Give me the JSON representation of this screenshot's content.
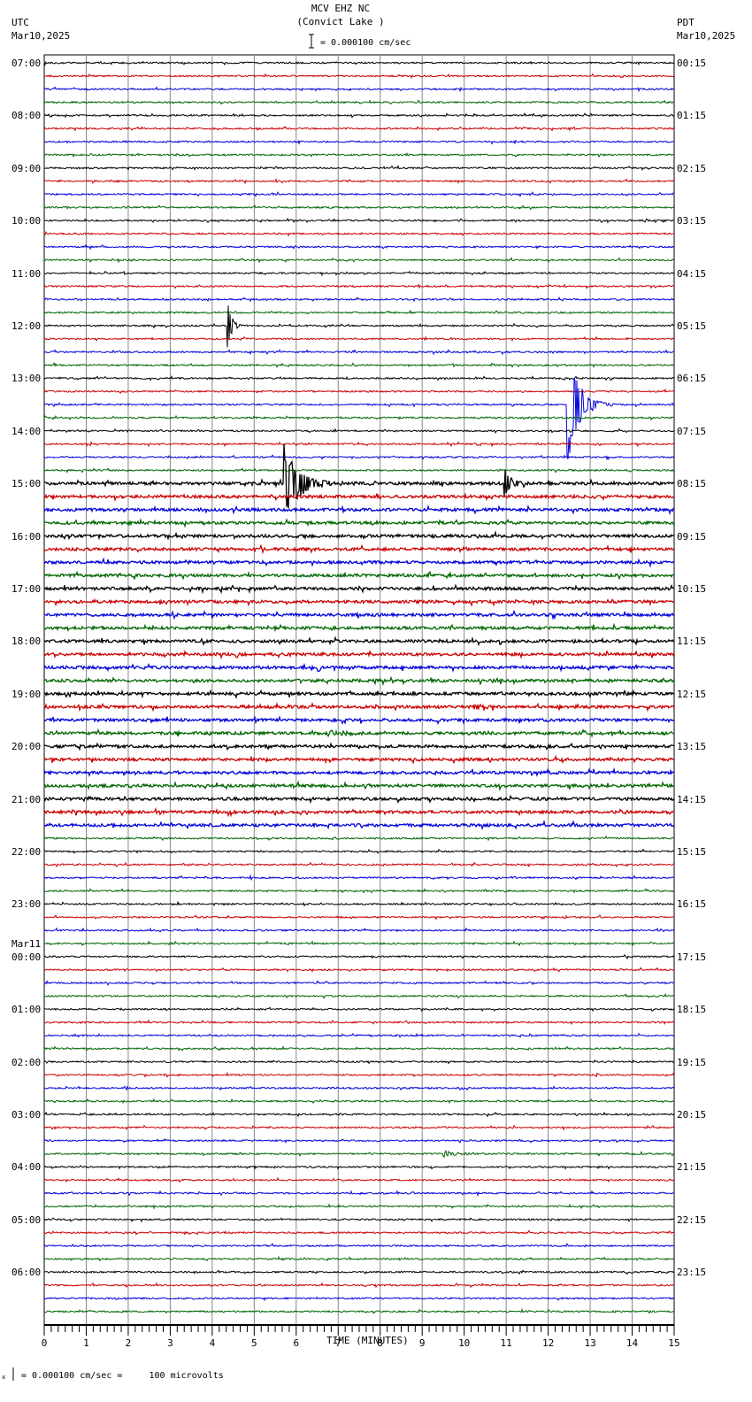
{
  "chart_data": {
    "type": "line",
    "title": "MCV EHZ NC",
    "subtitle": "(Convict Lake )",
    "left_tz": "UTC",
    "left_date": "Mar10,2025",
    "right_tz": "PDT",
    "right_date": "Mar10,2025",
    "scale_label": "= 0.000100 cm/sec",
    "footer_label": "= 0.000100 cm/sec =     100 microvolts",
    "footer_mark": "x",
    "xlabel": "TIME (MINUTES)",
    "xlim": [
      0,
      15
    ],
    "x_ticks": [
      "0",
      "1",
      "2",
      "3",
      "4",
      "5",
      "6",
      "7",
      "8",
      "9",
      "10",
      "11",
      "12",
      "13",
      "14",
      "15"
    ],
    "minutes_per_row": 15,
    "row_colors": [
      "#000000",
      "#cc0000",
      "#0000dd",
      "#006600"
    ],
    "left_labels": [
      "07:00",
      "08:00",
      "09:00",
      "10:00",
      "11:00",
      "12:00",
      "13:00",
      "14:00",
      "15:00",
      "16:00",
      "17:00",
      "18:00",
      "19:00",
      "20:00",
      "21:00",
      "22:00",
      "23:00",
      "00:00",
      "01:00",
      "02:00",
      "03:00",
      "04:00",
      "05:00",
      "06:00"
    ],
    "day_change_label": "Mar11",
    "right_labels": [
      "00:15",
      "01:15",
      "02:15",
      "03:15",
      "04:15",
      "05:15",
      "06:15",
      "07:15",
      "08:15",
      "09:15",
      "10:15",
      "11:15",
      "12:15",
      "13:15",
      "14:15",
      "15:15",
      "16:15",
      "17:15",
      "18:15",
      "19:15",
      "20:15",
      "21:15",
      "22:15",
      "23:15"
    ],
    "events": [
      {
        "row": 20,
        "minute": 4.35,
        "amplitude": 32,
        "decay": 0.1
      },
      {
        "row": 26,
        "minute": 12.45,
        "amplitude": 80,
        "decay": 0.25
      },
      {
        "row": 32,
        "minute": 5.7,
        "amplitude": 45,
        "decay": 0.35
      },
      {
        "row": 32,
        "minute": 10.95,
        "amplitude": 20,
        "decay": 0.15
      },
      {
        "row": 46,
        "minute": 6.5,
        "amplitude": 8,
        "decay": 0.05
      },
      {
        "row": 49,
        "minute": 10.2,
        "amplitude": 3,
        "decay": 0.3
      },
      {
        "row": 51,
        "minute": 6.8,
        "amplitude": 4,
        "decay": 0.3
      },
      {
        "row": 83,
        "minute": 9.5,
        "amplitude": 4,
        "decay": 0.3
      }
    ]
  }
}
